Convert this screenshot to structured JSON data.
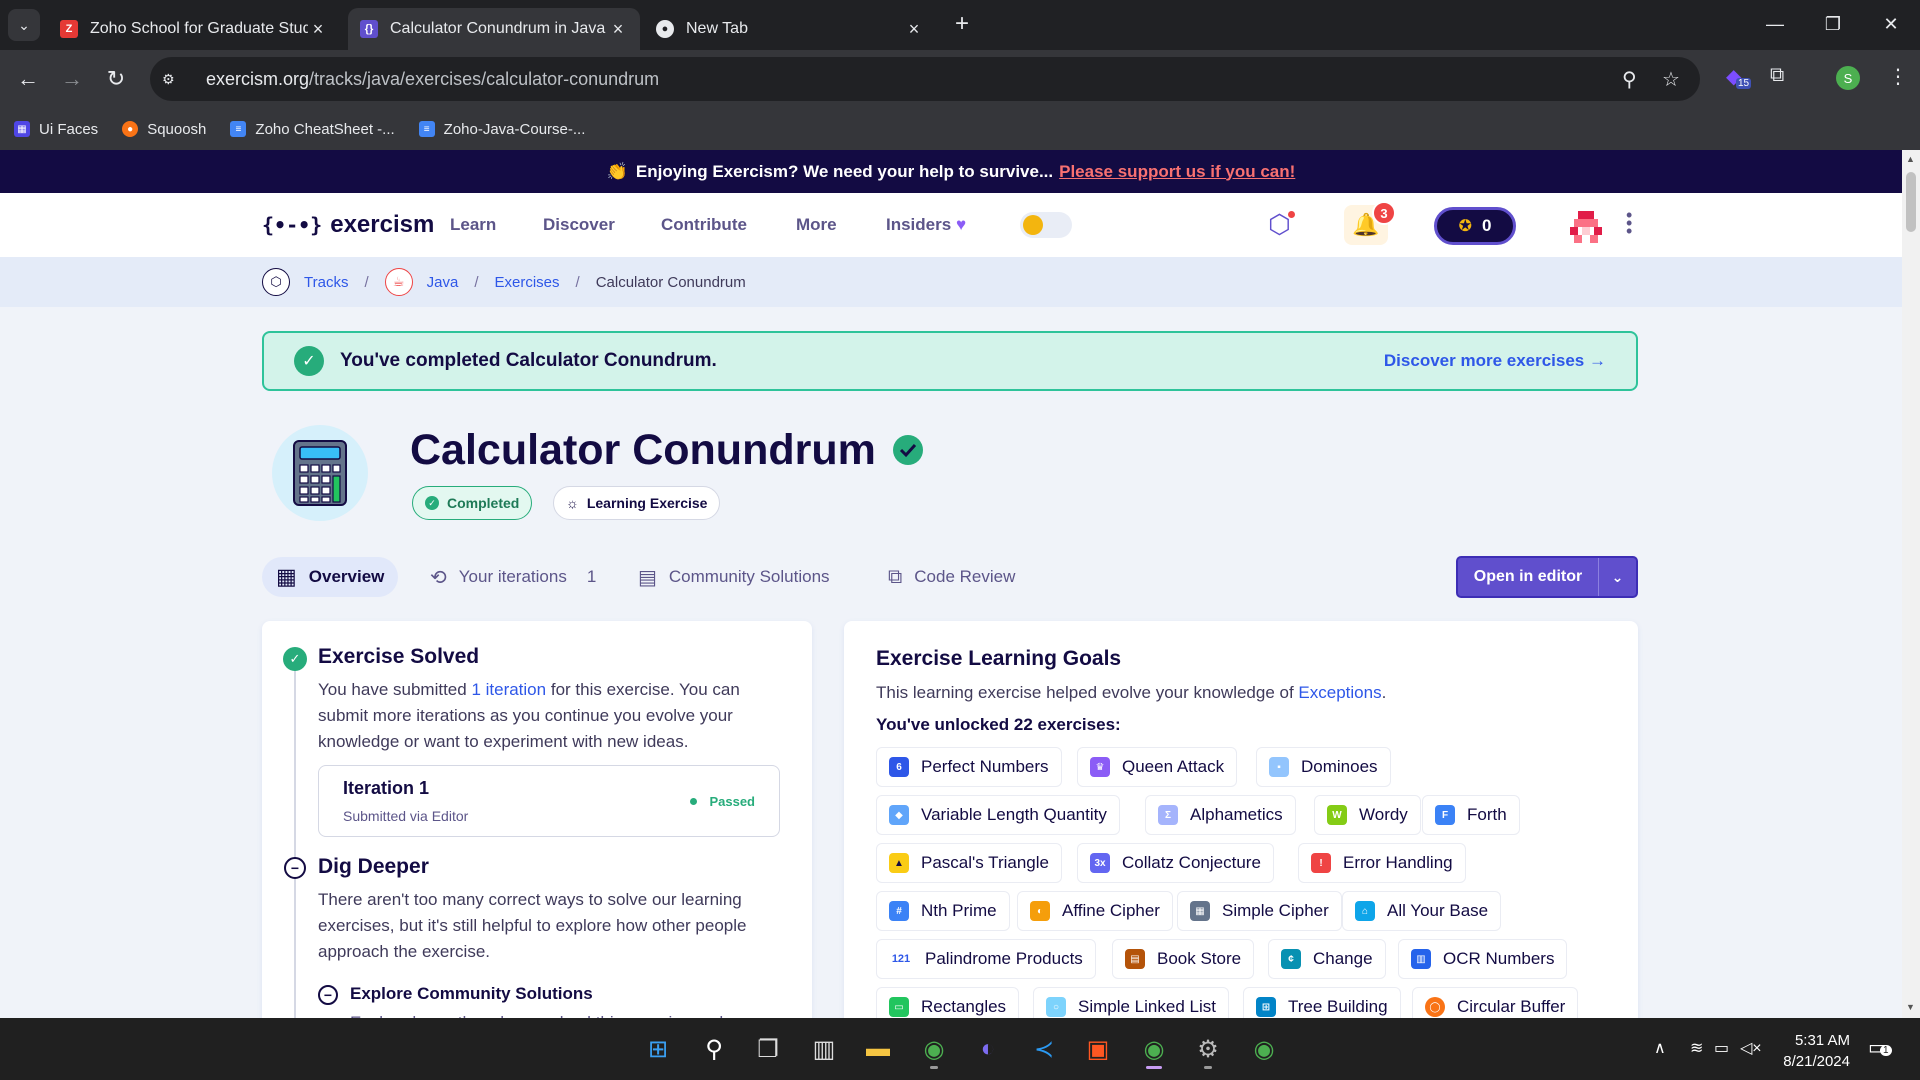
{
  "browser": {
    "tabs": [
      {
        "title": "Zoho School for Graduate Studi",
        "active": false
      },
      {
        "title": "Calculator Conundrum in Java o",
        "active": true
      },
      {
        "title": "New Tab",
        "active": false
      }
    ],
    "url_domain": "exercism.org",
    "url_path": "/tracks/java/exercises/calculator-conundrum",
    "extensions_badge": "15",
    "profile_initial": "S",
    "bookmarks": [
      {
        "label": "Ui Faces",
        "color": "#4f46e5"
      },
      {
        "label": "Squoosh",
        "color": "#f97316"
      },
      {
        "label": "Zoho CheatSheet -...",
        "color": "#4285f4"
      },
      {
        "label": "Zoho-Java-Course-...",
        "color": "#4285f4"
      }
    ]
  },
  "banner": {
    "emoji": "👏",
    "text": "Enjoying Exercism? We need your help to survive...",
    "link": "Please support us if you can!"
  },
  "site_nav": {
    "logo": "exercism",
    "logo_mark": "{•-•}",
    "items": [
      "Learn",
      "Discover",
      "Contribute",
      "More",
      "Insiders"
    ],
    "insiders_heart": "♥",
    "notification_count": "3",
    "reputation": "0"
  },
  "breadcrumb": {
    "tracks": "Tracks",
    "java": "Java",
    "exercises": "Exercises",
    "current": "Calculator Conundrum",
    "separator": "/"
  },
  "completion": {
    "message": "You've completed Calculator Conundrum.",
    "discover_link": "Discover more exercises"
  },
  "exercise": {
    "title": "Calculator Conundrum",
    "status_pill": "Completed",
    "type_pill": "Learning Exercise"
  },
  "tabs": {
    "overview": "Overview",
    "iterations": "Your iterations",
    "iterations_count": "1",
    "community": "Community Solutions",
    "code_review": "Code Review",
    "open_editor": "Open in editor"
  },
  "left_panel": {
    "solved_title": "Exercise Solved",
    "solved_text_1": "You have submitted",
    "solved_link": "1 iteration",
    "solved_text_2": "for this exercise. You can submit more iterations as you continue you evolve your knowledge or want to experiment with new ideas.",
    "iteration_title": "Iteration 1",
    "iteration_sub": "Submitted via Editor",
    "iteration_status": "Passed",
    "dig_title": "Dig Deeper",
    "dig_text": "There aren't too many correct ways to solve our learning exercises, but it's still helpful to explore how other people approach the exercise.",
    "explore_title": "Explore Community Solutions",
    "explore_text": "Explore how others have solved this exercise and"
  },
  "right_panel": {
    "title": "Exercise Learning Goals",
    "text": "This learning exercise helped evolve your knowledge of",
    "concept_link": "Exceptions",
    "period": ".",
    "unlocked": "You've unlocked 22 exercises:",
    "exercises": [
      {
        "name": "Perfect Numbers",
        "color": "#2e57e8",
        "glyph": "6"
      },
      {
        "name": "Queen Attack",
        "color": "#8b5cf6",
        "glyph": "♛"
      },
      {
        "name": "Dominoes",
        "color": "#93c5fd",
        "glyph": "▪"
      },
      {
        "name": "Variable Length Quantity",
        "color": "#60a5fa",
        "glyph": "◆"
      },
      {
        "name": "Alphametics",
        "color": "#a5b4fc",
        "glyph": "Σ"
      },
      {
        "name": "Wordy",
        "color": "#84cc16",
        "glyph": "W"
      },
      {
        "name": "Forth",
        "color": "#3b82f6",
        "glyph": "F"
      },
      {
        "name": "Pascal's Triangle",
        "color": "#facc15",
        "glyph": "▲"
      },
      {
        "name": "Collatz Conjecture",
        "color": "#6366f1",
        "glyph": "3x"
      },
      {
        "name": "Error Handling",
        "color": "#ef4444",
        "glyph": "!"
      },
      {
        "name": "Nth Prime",
        "color": "#3b82f6",
        "glyph": "#"
      },
      {
        "name": "Affine Cipher",
        "color": "#f59e0b",
        "glyph": "◐"
      },
      {
        "name": "Simple Cipher",
        "color": "#64748b",
        "glyph": "▦"
      },
      {
        "name": "All Your Base",
        "color": "#0ea5e9",
        "glyph": "⌂"
      },
      {
        "name": "Palindrome Products",
        "color": "#2e57e8",
        "glyph": "121"
      },
      {
        "name": "Book Store",
        "color": "#b45309",
        "glyph": "▤"
      },
      {
        "name": "Change",
        "color": "#0891b2",
        "glyph": "¢"
      },
      {
        "name": "OCR Numbers",
        "color": "#2563eb",
        "glyph": "▥"
      },
      {
        "name": "Rectangles",
        "color": "#22c55e",
        "glyph": "▭"
      },
      {
        "name": "Simple Linked List",
        "color": "#7dd3fc",
        "glyph": "○"
      },
      {
        "name": "Tree Building",
        "color": "#0284c7",
        "glyph": "⊞"
      },
      {
        "name": "Circular Buffer",
        "color": "#f97316",
        "glyph": "◯"
      }
    ]
  },
  "taskbar": {
    "time": "5:31 AM",
    "date": "8/21/2024",
    "notifications": "1"
  }
}
